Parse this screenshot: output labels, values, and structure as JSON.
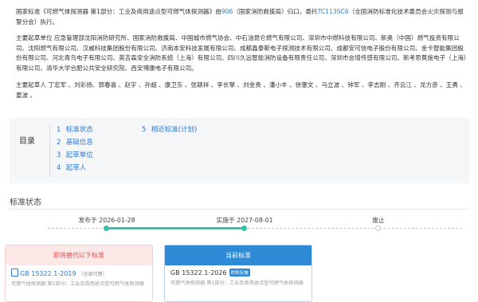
{
  "intro": {
    "p1_prefix": "国家标准《可燃气体探测器 第1部分：工业及商用途点型可燃气体探测器》由",
    "p1_code": "906",
    "p1_mid": "（国家消防救援局）归口，委托",
    "p1_committee": "TC113SC6",
    "p1_suffix": "（全国消防标准化技术委员会火灾探测与报警分会）执行。",
    "p2": "主要起草单位 应急管理部沈阳消防研究所、国家消防救援局、中国城市燃气协会、中石油昆仑燃气有限公司、深圳市中燃科技有限公司、新奥（中国）燃气投资有限公司、沈阳燃气有限公司、汉威科技集团股份有限公司、济南本安科技发展有限公司、成都鑫泰斯电子探测技术有限公司、成都安可信电子股份有限公司、金卡智能集团股份有限公司、河北青鸟电子有限公司、英吉森安全消防系统（上海）有限公司、四川久远智能消防设备有限责任公司、深圳市会增传感有限公司、新考思莫施电子（上海）有限公司、清华大学合肥公共安全研究院、西安博康电子有限公司。",
    "p3": "主要起草人 丁宏军 、刘彩扬、郭春喜 、赵宇 、孙超 、康卫东 、张颖祥 、李长擘 、刘金贵 、潘小丰 、徐肇文 、马立波 、钟军 、李志刚 、齐云江 、龙方彦 、王勇 、姜波 。"
  },
  "toc": {
    "title": "目录",
    "items_col1": [
      {
        "num": "1",
        "label": "标准状态"
      },
      {
        "num": "2",
        "label": "基础信息"
      },
      {
        "num": "3",
        "label": "起草单位"
      },
      {
        "num": "4",
        "label": "起草人"
      }
    ],
    "items_col2": [
      {
        "num": "5",
        "label": "相近标准(计划)"
      }
    ]
  },
  "status": {
    "title": "标准状态",
    "timeline": [
      {
        "label": "发布于 2026-01-28"
      },
      {
        "label": "实施于 2027-08-01"
      },
      {
        "label": "废止"
      }
    ]
  },
  "cards": {
    "old": {
      "header": "即将替代以下标准",
      "code": "GB 15322.1-2019",
      "tag": "（全部代替）",
      "desc": "可燃气体探测器 第1部分：工业及商用途点型可燃气体探测器"
    },
    "current": {
      "header": "当前标准",
      "code": "GB 15322.1-2026",
      "badge": "即将实施",
      "desc": "可燃气体探测器 第1部分：工业及商用途点型可燃气体探测器"
    }
  },
  "colors": {
    "link": "#2d7bd6",
    "timeline_active": "#36c4a8",
    "old_header_bg": "#fde8e8",
    "current_header_bg": "#2f8ad6"
  }
}
